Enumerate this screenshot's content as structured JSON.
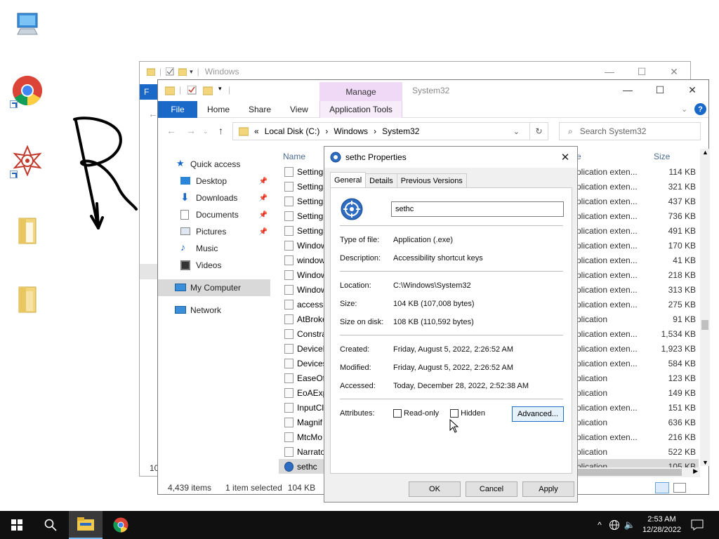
{
  "desktop": {
    "icons": [
      {
        "name": "this-pc"
      },
      {
        "name": "chrome-shortcut"
      },
      {
        "name": "app-shortcut"
      },
      {
        "name": "folder-1"
      },
      {
        "name": "folder-2"
      }
    ]
  },
  "back_window": {
    "title": "Windows",
    "controls": {
      "minimize": "—",
      "maximize": "☐",
      "close": "✕"
    },
    "left_fragment": "10"
  },
  "explorer": {
    "title": "System32",
    "manage_tab": "Manage",
    "ribbon_tabs": {
      "file": "File",
      "home": "Home",
      "share": "Share",
      "view": "View",
      "app_tools": "Application Tools"
    },
    "controls": {
      "minimize": "—",
      "maximize": "☐",
      "close": "✕"
    },
    "address": {
      "overflow": "«",
      "parts": [
        "Local Disk (C:)",
        "Windows",
        "System32"
      ],
      "sep": "›"
    },
    "search_placeholder": "Search System32",
    "nav": [
      {
        "label": "Quick access",
        "icon": "star-icon"
      },
      {
        "label": "Desktop",
        "icon": "desktop-icon",
        "pinned": true
      },
      {
        "label": "Downloads",
        "icon": "download-icon",
        "pinned": true
      },
      {
        "label": "Documents",
        "icon": "documents-icon",
        "pinned": true
      },
      {
        "label": "Pictures",
        "icon": "pictures-icon",
        "pinned": true
      },
      {
        "label": "Music",
        "icon": "music-icon"
      },
      {
        "label": "Videos",
        "icon": "videos-icon"
      },
      {
        "label": "My Computer",
        "icon": "computer-icon",
        "selected": true
      },
      {
        "label": "Network",
        "icon": "network-icon"
      }
    ],
    "columns": {
      "name": "Name",
      "type": "e",
      "size": "Size"
    },
    "files": [
      {
        "name": "Settings",
        "type": "plication exten...",
        "size": "114 KB"
      },
      {
        "name": "Settings",
        "type": "plication exten...",
        "size": "321 KB"
      },
      {
        "name": "Settings",
        "type": "plication exten...",
        "size": "437 KB"
      },
      {
        "name": "Settings",
        "type": "plication exten...",
        "size": "736 KB"
      },
      {
        "name": "Settings",
        "type": "plication exten...",
        "size": "491 KB"
      },
      {
        "name": "Windows",
        "type": "plication exten...",
        "size": "170 KB"
      },
      {
        "name": "windows",
        "type": "plication exten...",
        "size": "41 KB"
      },
      {
        "name": "Windows",
        "type": "plication exten...",
        "size": "218 KB"
      },
      {
        "name": "Windows",
        "type": "plication exten...",
        "size": "313 KB"
      },
      {
        "name": "accessib",
        "type": "plication exten...",
        "size": "275 KB"
      },
      {
        "name": "AtBroke",
        "type": "plication",
        "size": "91 KB"
      },
      {
        "name": "Constrai",
        "type": "plication exten...",
        "size": "1,534 KB"
      },
      {
        "name": "DeviceF",
        "type": "plication exten...",
        "size": "1,923 KB"
      },
      {
        "name": "Devices",
        "type": "plication exten...",
        "size": "584 KB"
      },
      {
        "name": "EaseOfA",
        "type": "plication",
        "size": "123 KB"
      },
      {
        "name": "EoAExp",
        "type": "plication",
        "size": "149 KB"
      },
      {
        "name": "InputCl",
        "type": "plication exten...",
        "size": "151 KB"
      },
      {
        "name": "Magnif",
        "type": "plication",
        "size": "636 KB"
      },
      {
        "name": "MtcMo",
        "type": "plication exten...",
        "size": "216 KB"
      },
      {
        "name": "Narrato",
        "type": "plication",
        "size": "522 KB"
      },
      {
        "name": "sethc",
        "type": "plication",
        "size": "105 KB",
        "selected": true
      }
    ],
    "status": {
      "items": "4,439 items",
      "selected": "1 item selected",
      "size": "104 KB"
    }
  },
  "dialog": {
    "title": "sethc Properties",
    "tabs": [
      "General",
      "Details",
      "Previous Versions"
    ],
    "name": "sethc",
    "type_label": "Type of file:",
    "type_value": "Application (.exe)",
    "desc_label": "Description:",
    "desc_value": "Accessibility shortcut keys",
    "loc_label": "Location:",
    "loc_value": "C:\\Windows\\System32",
    "size_label": "Size:",
    "size_value": "104 KB (107,008 bytes)",
    "disk_label": "Size on disk:",
    "disk_value": "108 KB (110,592 bytes)",
    "created_label": "Created:",
    "created_value": "Friday, August 5, 2022, 2:26:52 AM",
    "modified_label": "Modified:",
    "modified_value": "Friday, August 5, 2022, 2:26:52 AM",
    "accessed_label": "Accessed:",
    "accessed_value": "Today, December 28, 2022, 2:52:38 AM",
    "attr_label": "Attributes:",
    "readonly": "Read-only",
    "hidden": "Hidden",
    "advanced": "Advanced...",
    "ok": "OK",
    "cancel": "Cancel",
    "apply": "Apply",
    "close": "✕"
  },
  "taskbar": {
    "time": "2:53 AM",
    "date": "12/28/2022"
  }
}
